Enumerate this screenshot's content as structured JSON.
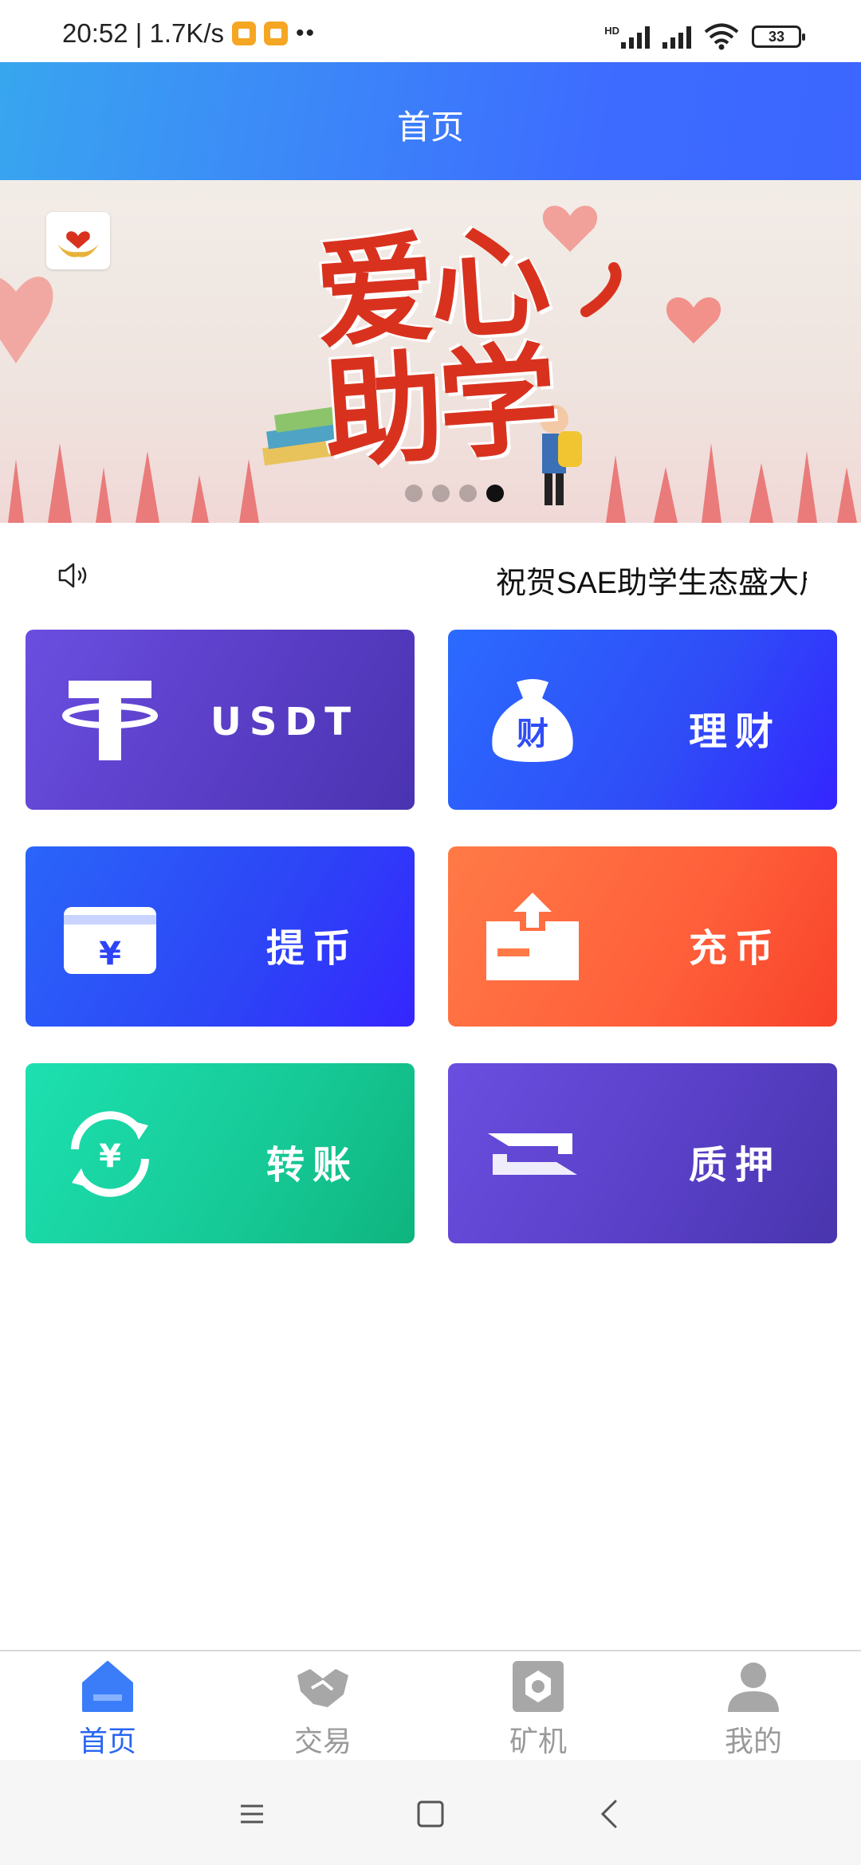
{
  "status_bar": {
    "time_speed": "20:52 | 1.7K/s",
    "dots": "••",
    "hd": "HD",
    "battery": "33"
  },
  "header": {
    "title": "首页"
  },
  "banner": {
    "text": "爱心助学",
    "dot_count": 4,
    "active_dot": 4
  },
  "notice": {
    "text": "祝贺SAE助学生态盛大启航"
  },
  "tiles": [
    {
      "label": "USDT",
      "icon": "tether-icon"
    },
    {
      "label": "理财",
      "icon": "money-bag-icon"
    },
    {
      "label": "提币",
      "icon": "yuan-card-icon"
    },
    {
      "label": "充币",
      "icon": "upload-box-icon"
    },
    {
      "label": "转账",
      "icon": "yuan-transfer-icon"
    },
    {
      "label": "质押",
      "icon": "pledge-icon"
    }
  ],
  "tabbar": {
    "items": [
      {
        "label": "首页",
        "icon": "home-icon",
        "active": true
      },
      {
        "label": "交易",
        "icon": "handshake-icon",
        "active": false
      },
      {
        "label": "矿机",
        "icon": "miner-icon",
        "active": false
      },
      {
        "label": "我的",
        "icon": "user-icon",
        "active": false
      }
    ]
  },
  "colors": {
    "accent": "#2a66f2",
    "header_start": "#38a6ef",
    "header_end": "#3c66ff"
  }
}
